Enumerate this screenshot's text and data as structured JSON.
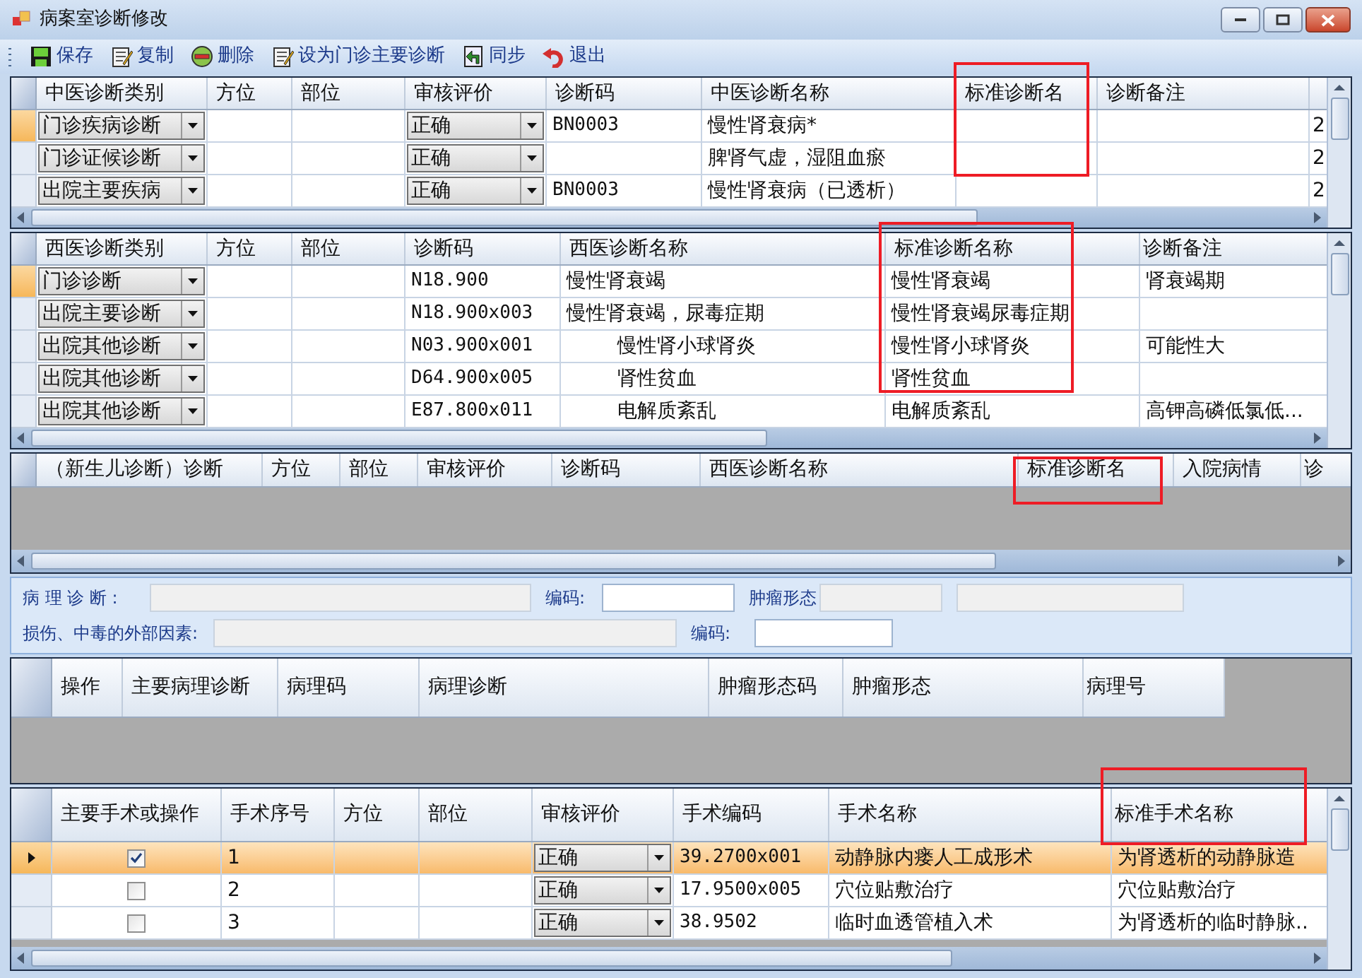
{
  "window": {
    "title": "病案室诊断修改"
  },
  "toolbar": [
    {
      "label": "保存",
      "kind": "save"
    },
    {
      "label": "复制",
      "kind": "clipboard"
    },
    {
      "label": "删除",
      "kind": "delete"
    },
    {
      "label": "设为门诊主要诊断",
      "kind": "clipboard"
    },
    {
      "label": "同步",
      "kind": "sync"
    },
    {
      "label": "退出",
      "kind": "exit"
    }
  ],
  "grids": [
    {
      "columns": [
        {
          "label": "中医诊断类别",
          "kind": "combo"
        },
        {
          "label": "方位"
        },
        {
          "label": "部位"
        },
        {
          "label": "审核评价",
          "kind": "combo"
        },
        {
          "label": "诊断码",
          "kind": "code"
        },
        {
          "label": "中医诊断名称"
        },
        {
          "label": "标准诊断名",
          "highlighted": true
        },
        {
          "label": "诊断备注"
        },
        {}
      ],
      "rows": [
        {
          "selected": true,
          "cells": [
            "门诊疾病诊断",
            null,
            null,
            "正确",
            "BN0003",
            "慢性肾衰病*",
            null,
            null,
            "2"
          ]
        },
        {
          "selected": false,
          "cells": [
            "门诊证候诊断",
            null,
            null,
            "正确",
            null,
            "脾肾气虚，湿阻血瘀",
            null,
            null,
            "2"
          ]
        },
        {
          "selected": false,
          "cells": [
            "出院主要疾病",
            null,
            null,
            "正确",
            "BN0003",
            "慢性肾衰病（已透析）",
            null,
            null,
            "2"
          ]
        }
      ]
    },
    {
      "columns": [
        {
          "label": "西医诊断类别",
          "kind": "combo"
        },
        {
          "label": "方位"
        },
        {
          "label": "部位"
        },
        {
          "label": "诊断码",
          "kind": "code"
        },
        {
          "label": "西医诊断名称"
        },
        {
          "label": "标准诊断名称",
          "highlighted": true
        },
        {
          "label": "诊断备注"
        }
      ],
      "rows": [
        {
          "selected": true,
          "cells": [
            "门诊诊断",
            null,
            null,
            "N18.900",
            "慢性肾衰竭",
            "慢性肾衰竭",
            "肾衰竭期"
          ]
        },
        {
          "selected": false,
          "cells": [
            "出院主要诊断",
            null,
            null,
            "N18.900x003",
            "慢性肾衰竭，尿毒症期",
            "慢性肾衰竭尿毒症期",
            null
          ]
        },
        {
          "selected": false,
          "cells": [
            "出院其他诊断",
            null,
            null,
            "N03.900x001",
            {
              "text": "慢性肾小球肾炎",
              "indented": true
            },
            "慢性肾小球肾炎",
            "可能性大"
          ]
        },
        {
          "selected": false,
          "cells": [
            "出院其他诊断",
            null,
            null,
            "D64.900x005",
            {
              "text": "肾性贫血",
              "indented": true
            },
            "肾性贫血",
            null
          ]
        },
        {
          "selected": false,
          "cells": [
            "出院其他诊断",
            null,
            null,
            "E87.800x011",
            {
              "text": "电解质紊乱",
              "indented": true
            },
            "电解质紊乱",
            "高钾高磷低氯低..."
          ]
        }
      ]
    },
    {
      "columns": [
        {
          "label": "（新生儿诊断）诊断"
        },
        {
          "label": "方位"
        },
        {
          "label": "部位"
        },
        {
          "label": "审核评价"
        },
        {
          "label": "诊断码"
        },
        {
          "label": "西医诊断名称"
        },
        {
          "label": "标准诊断名",
          "highlighted": true
        },
        {
          "label": "入院病情"
        },
        {
          "label": "诊"
        }
      ]
    },
    {
      "columns": [
        {
          "label": "操作"
        },
        {
          "label": "主要病理诊断"
        },
        {
          "label": "病理码"
        },
        {
          "label": "病理诊断"
        },
        {
          "label": "肿瘤形态码"
        },
        {
          "label": "肿瘤形态"
        },
        {
          "label": "病理号"
        }
      ]
    },
    {
      "columns": [
        {
          "label": "主要手术或操作",
          "kind": "check"
        },
        {
          "label": "手术序号"
        },
        {
          "label": "方位"
        },
        {
          "label": "部位"
        },
        {
          "label": "审核评价",
          "kind": "combo"
        },
        {
          "label": "手术编码",
          "kind": "code"
        },
        {
          "label": "手术名称"
        },
        {
          "label": "标准手术名称",
          "highlighted": true
        }
      ],
      "rows": [
        {
          "selected": true,
          "cells": [
            {
              "checked": true
            },
            "1",
            null,
            null,
            "正确",
            "39.2700x001",
            "动静脉内瘘人工成形术",
            "为肾透析的动静脉造"
          ]
        },
        {
          "selected": false,
          "cells": [
            {
              "checked": false
            },
            "2",
            null,
            null,
            "正确",
            "17.9500x005",
            "穴位贴敷治疗",
            "穴位贴敷治疗"
          ]
        },
        {
          "selected": false,
          "cells": [
            {
              "checked": false
            },
            "3",
            null,
            null,
            "正确",
            "38.9502",
            "临时血透管植入术",
            "为肾透析的临时静脉.."
          ]
        }
      ]
    }
  ],
  "pathology_form": {
    "rows": [
      [
        {
          "label": "病 理 诊 断 :",
          "disabled": true
        },
        {
          "label": "编码:",
          "disabled": false
        },
        {
          "label": "肿瘤形态",
          "disabled": true
        },
        {
          "disabled": true
        }
      ],
      [
        {
          "label": "损伤、中毒的外部因素:",
          "disabled": true
        },
        {
          "label": "编码:",
          "disabled": false
        }
      ]
    ]
  }
}
